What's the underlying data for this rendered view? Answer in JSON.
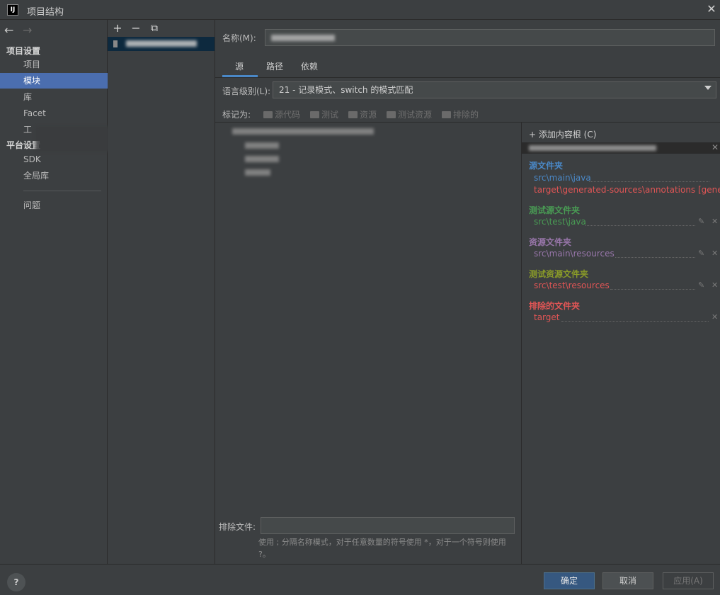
{
  "window": {
    "app_icon_text": "IJ",
    "title": "项目结构",
    "close_glyph": "✕"
  },
  "sidebar": {
    "back_glyph": "←",
    "forward_glyph": "→",
    "section_project": "项目设置",
    "items_project": [
      "项目",
      "模块",
      "库",
      "Facet",
      "工"
    ],
    "selected": "模块",
    "section_platform": "平台设置",
    "items_platform": [
      "SDK",
      "全局库"
    ],
    "problems": "问题"
  },
  "module_toolbar": {
    "add": "+",
    "remove": "−",
    "copy": "⧉"
  },
  "main": {
    "name_label": "名称(M):",
    "tabs": [
      "源",
      "路径",
      "依赖"
    ],
    "active_tab": "源",
    "lang_label": "语言级别(L):",
    "lang_value": "21 - 记录模式、switch 的模式匹配",
    "mark_label": "标记为:",
    "mark_items": [
      "源代码",
      "测试",
      "资源",
      "测试资源",
      "排除的"
    ],
    "exclude_label": "排除文件:",
    "exclude_hint": "使用 ; 分隔名称模式，对于任意数量的符号使用 *，对于一个符号则使用 ?。"
  },
  "roots": {
    "add_label": "+ 添加内容根 (C)",
    "groups": [
      {
        "title": "源文件夹",
        "color": "#4a88c7",
        "paths": [
          {
            "text": "src\\main\\java",
            "color": "#4a88c7"
          },
          {
            "text": "target\\generated-sources\\annotations [gener",
            "color": "#e05555"
          }
        ]
      },
      {
        "title": "测试源文件夹",
        "color": "#499c54",
        "paths": [
          {
            "text": "src\\test\\java",
            "color": "#499c54"
          }
        ]
      },
      {
        "title": "资源文件夹",
        "color": "#9876aa",
        "paths": [
          {
            "text": "src\\main\\resources",
            "color": "#9876aa"
          }
        ]
      },
      {
        "title": "测试资源文件夹",
        "color": "#8a9b28",
        "paths": [
          {
            "text": "src\\test\\resources",
            "color": "#e05555"
          }
        ]
      },
      {
        "title": "排除的文件夹",
        "color": "#e05555",
        "paths": [
          {
            "text": "target",
            "color": "#e05555"
          }
        ]
      }
    ]
  },
  "buttons": {
    "help": "?",
    "ok": "确定",
    "cancel": "取消",
    "apply": "应用(A)"
  }
}
